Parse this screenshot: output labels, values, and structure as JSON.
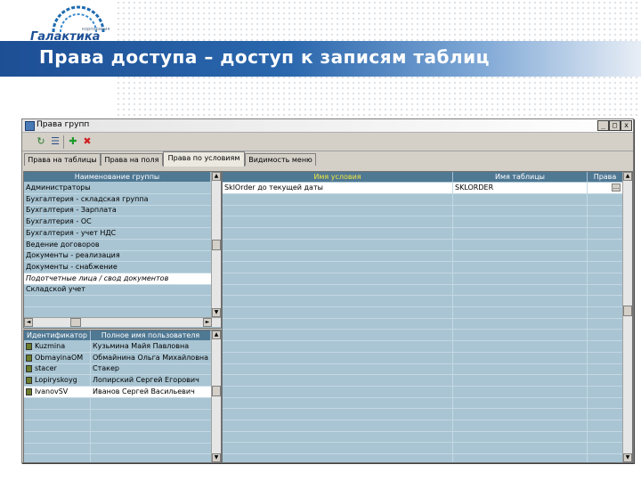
{
  "slide": {
    "title": "Права доступа – доступ к записям таблиц",
    "logo_text": "Галактика",
    "logo_corp": "корпорация"
  },
  "window": {
    "title": "Права групп",
    "buttons": {
      "minimize": "_",
      "maximize": "□",
      "close": "x"
    },
    "toolbar": [
      "refresh-icon",
      "list-icon",
      "add-icon",
      "delete-icon"
    ],
    "tabs": [
      {
        "label": "Права на таблицы",
        "active": false
      },
      {
        "label": "Права на поля",
        "active": false
      },
      {
        "label": "Права по условиям",
        "active": true
      },
      {
        "label": "Видимость меню",
        "active": false
      }
    ]
  },
  "groups": {
    "header": "Наименование группы",
    "rows": [
      "Администраторы",
      "Бухгалтерия - складская группа",
      "Бухгалтерия - Зарплата",
      "Бухгалтерия - ОС",
      "Бухгалтерия - учет НДС",
      "Ведение договоров",
      "Документы - реализация",
      "Документы - снабжение",
      "Подотчетные лица / свод документов",
      "Складской учет"
    ],
    "selected_index": 8
  },
  "users": {
    "headers": [
      "Идентификатор",
      "Полное имя пользователя"
    ],
    "rows": [
      [
        "Kuzmina",
        "Кузьмина Майя Павловна"
      ],
      [
        "ObmayinaOM",
        "Обмайнина Ольга Михайловна"
      ],
      [
        "stacer",
        "Стакер"
      ],
      [
        "Lopiryskoyg",
        "Лопирский Сергей Егорович"
      ],
      [
        "IvanovSV",
        "Иванов Сергей Васильевич"
      ]
    ],
    "selected_index": 4
  },
  "conditions": {
    "headers": [
      "Имя условия",
      "Имя таблицы",
      "Права"
    ],
    "rows": [
      [
        "SklOrder до текущей даты",
        "SKLORDER",
        ""
      ]
    ],
    "ellipsis": "..."
  },
  "scroll": {
    "up": "▲",
    "down": "▼",
    "left": "◄",
    "right": "►"
  }
}
